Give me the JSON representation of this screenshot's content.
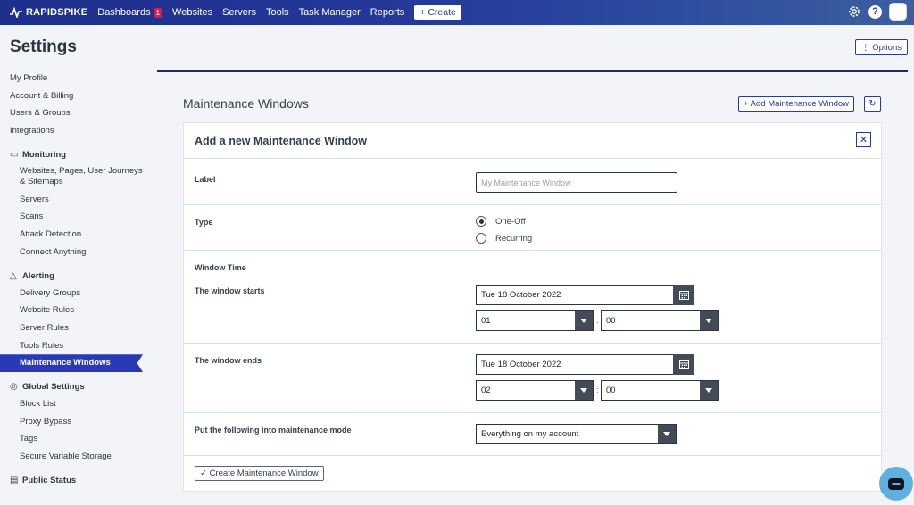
{
  "topnav": {
    "logo": "RAPIDSPIKE",
    "items": [
      "Dashboards",
      "Websites",
      "Servers",
      "Tools",
      "Task Manager",
      "Reports"
    ],
    "dashboards_badge": "1",
    "create_label": "+ Create",
    "help_label": "?"
  },
  "page": {
    "title": "Settings",
    "options_label": "⋮ Options"
  },
  "sidebar": {
    "top": [
      "My Profile",
      "Account & Billing",
      "Users & Groups",
      "Integrations"
    ],
    "monitoring": {
      "title": "Monitoring",
      "items": [
        "Websites, Pages, User Journeys & Sitemaps",
        "Servers",
        "Scans",
        "Attack Detection",
        "Connect Anything"
      ]
    },
    "alerting": {
      "title": "Alerting",
      "items": [
        "Delivery Groups",
        "Website Rules",
        "Server Rules",
        "Tools Rules",
        "Maintenance Windows"
      ]
    },
    "global": {
      "title": "Global Settings",
      "items": [
        "Block List",
        "Proxy Bypass",
        "Tags",
        "Secure Variable Storage"
      ]
    },
    "public": {
      "title": "Public Status"
    }
  },
  "main": {
    "title": "Maintenance Windows",
    "add_label": "+ Add Maintenance Window",
    "refresh_icon": "↻",
    "card": {
      "title": "Add a new Maintenance Window",
      "close_icon": "✕",
      "label_field": {
        "label": "Label",
        "placeholder": "My Maintenance Window"
      },
      "type": {
        "label": "Type",
        "options": [
          "One-Off",
          "Recurring"
        ],
        "selected": "One-Off"
      },
      "window_time": {
        "heading": "Window Time"
      },
      "starts": {
        "label": "The window starts",
        "date": "Tue 18 October 2022",
        "hour": "01",
        "minute": "00"
      },
      "ends": {
        "label": "The window ends",
        "date": "Tue 18 October 2022",
        "hour": "02",
        "minute": "00"
      },
      "mode": {
        "label": "Put the following into maintenance mode",
        "value": "Everything on my account"
      },
      "submit_label": "✓ Create Maintenance Window"
    }
  },
  "colors": {
    "nav": "#24399a",
    "accent": "#2a39b8",
    "dark_btn": "#424b57",
    "chat": "#5fb0df"
  }
}
